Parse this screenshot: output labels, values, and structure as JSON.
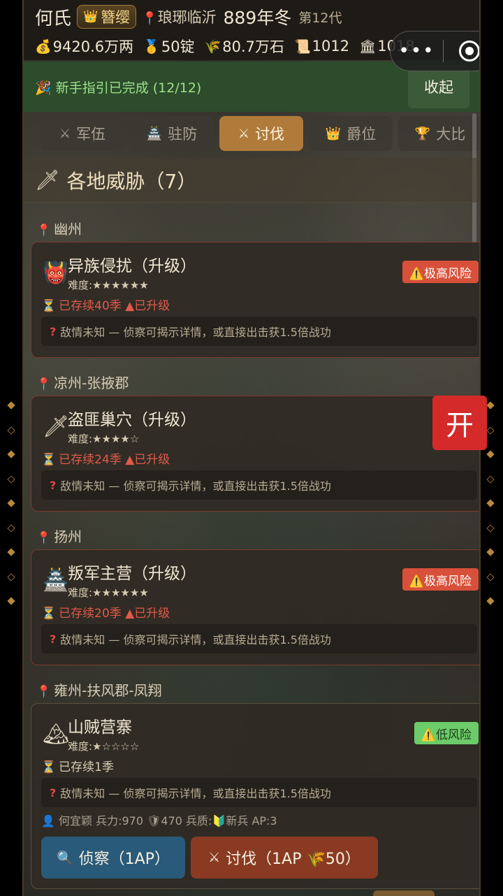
{
  "header": {
    "clan_name": "何氏",
    "rank": "簪缨",
    "location": "琅琊临沂",
    "year": "889年冬",
    "generation": "第12代",
    "resources": [
      {
        "icon": "money-bag-icon",
        "glyph": "💰",
        "value": "9420.6万两"
      },
      {
        "icon": "silver-ingot-icon",
        "glyph": "🥇",
        "value": "50锭"
      },
      {
        "icon": "grain-icon",
        "glyph": "🌾",
        "value": "80.7万石"
      },
      {
        "icon": "scroll-icon",
        "glyph": "📜",
        "value": "1012"
      },
      {
        "icon": "building-icon",
        "glyph": "🏛",
        "value": "1018"
      }
    ]
  },
  "capsule": {
    "more": "•••"
  },
  "guide": {
    "icon": "🎉",
    "text": "新手指引已完成 (12/12)",
    "collapse_label": "收起"
  },
  "tabs": [
    {
      "label": "军伍",
      "glyph": "⚔",
      "icon": "crossed-swords-icon",
      "active": false
    },
    {
      "label": "驻防",
      "glyph": "🏯",
      "icon": "castle-icon",
      "active": false
    },
    {
      "label": "讨伐",
      "glyph": "⚔",
      "icon": "crossed-swords-icon",
      "active": true
    },
    {
      "label": "爵位",
      "glyph": "👑",
      "icon": "crown-icon",
      "active": false
    },
    {
      "label": "大比",
      "glyph": "🏆",
      "icon": "trophy-icon",
      "active": false
    }
  ],
  "section": {
    "title": "各地威胁（7）",
    "glyph": "🗡"
  },
  "threats": [
    {
      "region": "幽州",
      "name": "异族侵扰（升级）",
      "emblem": "👹",
      "difficulty": "难度:★★★★★★",
      "duration": "已存续40季",
      "upgraded": "▲已升级",
      "risk": "⚠️极高风险",
      "risk_level": "high",
      "intel": "敌情未知 — 侦察可揭示详情，或直接出击获1.5倍战功"
    },
    {
      "region": "凉州-张掖郡",
      "name": "盗匪巢穴（升级）",
      "emblem": "🗡",
      "difficulty": "难度:★★★★☆",
      "duration": "已存续24季",
      "upgraded": "▲已升级",
      "risk": "⚠️",
      "risk_level": "medium",
      "intel": "敌情未知 — 侦察可揭示详情，或直接出击获1.5倍战功"
    },
    {
      "region": "扬州",
      "name": "叛军主营（升级）",
      "emblem": "🏯",
      "difficulty": "难度:★★★★★★",
      "duration": "已存续20季",
      "upgraded": "▲已升级",
      "risk": "⚠️极高风险",
      "risk_level": "high",
      "intel": "敌情未知 — 侦察可揭示详情，或直接出击获1.5倍战功"
    },
    {
      "region": "雍州-扶风郡-凤翔",
      "name": "山贼营寨",
      "emblem": "🏔",
      "difficulty": "难度:★☆☆☆☆",
      "duration": "已存续1季",
      "upgraded": "",
      "risk": "⚠️低风险",
      "risk_level": "low",
      "intel": "敌情未知 — 侦察可揭示详情，或直接出击获1.5倍战功",
      "unit_info": "👤 何宜颖 兵力:970 🛡470 兵质:🔰新兵 AP:3",
      "scout_label": "侦察（1AP）",
      "attack_label": "讨伐（1AP 🌾50）"
    }
  ],
  "float_button": "开"
}
